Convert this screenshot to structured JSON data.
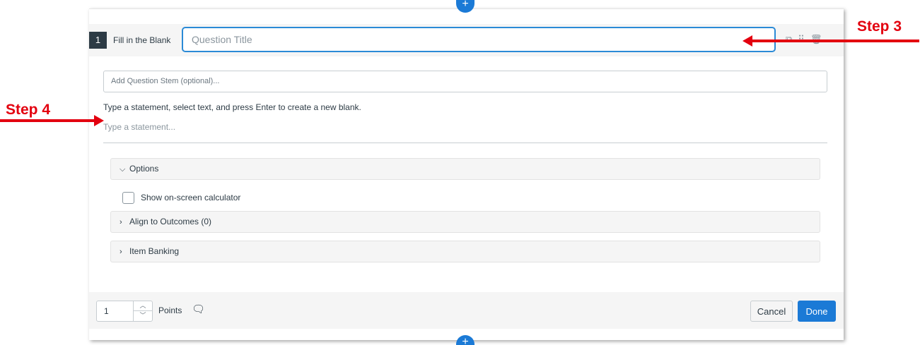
{
  "question": {
    "number": "1",
    "type_label": "Fill in the Blank",
    "title_placeholder": "Question Title",
    "stem_placeholder": "Add Question Stem (optional)...",
    "instruction": "Type a statement, select text, and press Enter to create a new blank.",
    "statement_placeholder": "Type a statement..."
  },
  "header_icons": [
    "copy-icon",
    "drag-handle-icon",
    "trash-icon"
  ],
  "sections": {
    "options": {
      "label": "Options",
      "expanded": true
    },
    "calculator": {
      "label": "Show on-screen calculator",
      "checked": false
    },
    "outcomes": {
      "label": "Align to Outcomes (0)",
      "expanded": false
    },
    "item_banking": {
      "label": "Item Banking",
      "expanded": false
    }
  },
  "footer": {
    "points_value": "1",
    "points_label": "Points",
    "cancel_label": "Cancel",
    "done_label": "Done"
  },
  "annotations": {
    "step3": "Step 3",
    "step4": "Step 4"
  },
  "colors": {
    "accent": "#1b7ad6",
    "annotation": "#e3000f",
    "dark": "#2d3b45"
  }
}
